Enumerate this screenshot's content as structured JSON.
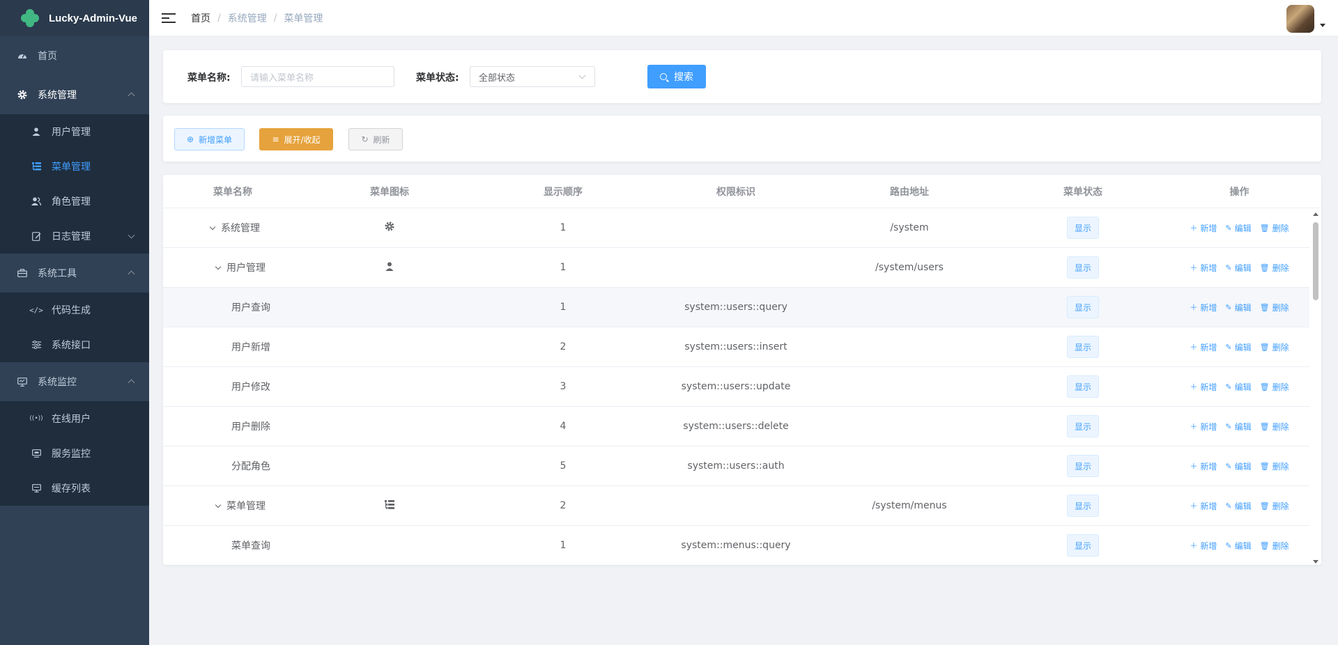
{
  "app": {
    "title": "Lucky-Admin-Vue"
  },
  "sidebar": {
    "home": "首页",
    "groups": [
      {
        "label": "系统管理",
        "expanded": true,
        "items": [
          {
            "label": "用户管理",
            "icon": "user-icon"
          },
          {
            "label": "菜单管理",
            "icon": "tree-table-icon",
            "active": true
          },
          {
            "label": "角色管理",
            "icon": "peoples-icon"
          },
          {
            "label": "日志管理",
            "icon": "log-icon",
            "collapsed_arrow": true
          }
        ]
      },
      {
        "label": "系统工具",
        "expanded": true,
        "items": [
          {
            "label": "代码生成",
            "icon": "code-icon"
          },
          {
            "label": "系统接口",
            "icon": "sliders-icon"
          }
        ]
      },
      {
        "label": "系统监控",
        "expanded": true,
        "items": [
          {
            "label": "在线用户",
            "icon": "online-icon"
          },
          {
            "label": "服务监控",
            "icon": "server-icon"
          },
          {
            "label": "缓存列表",
            "icon": "monitor-icon"
          }
        ]
      }
    ]
  },
  "breadcrumb": {
    "home": "首页",
    "level1": "系统管理",
    "level2": "菜单管理",
    "sep": "/"
  },
  "search": {
    "name_label": "菜单名称:",
    "name_placeholder": "请输入菜单名称",
    "status_label": "菜单状态:",
    "status_value": "全部状态",
    "search_button": "搜索"
  },
  "toolbar": {
    "add": "新增菜单",
    "expand": "展开/收起",
    "refresh": "刷新"
  },
  "table": {
    "headers": [
      "菜单名称",
      "菜单图标",
      "显示顺序",
      "权限标识",
      "路由地址",
      "菜单状态",
      "操作"
    ],
    "ops": {
      "add": "新增",
      "edit": "编辑",
      "delete": "删除"
    },
    "rows": [
      {
        "name": "系统管理",
        "level": 0,
        "expandable": true,
        "icon": "gear-icon",
        "order": "1",
        "perm": "",
        "route": "/system",
        "status": "显示"
      },
      {
        "name": "用户管理",
        "level": 1,
        "expandable": true,
        "icon": "user-icon",
        "order": "1",
        "perm": "",
        "route": "/system/users",
        "status": "显示"
      },
      {
        "name": "用户查询",
        "level": 2,
        "expandable": false,
        "icon": "",
        "order": "1",
        "perm": "system::users::query",
        "route": "",
        "status": "显示",
        "hover": true
      },
      {
        "name": "用户新增",
        "level": 2,
        "expandable": false,
        "icon": "",
        "order": "2",
        "perm": "system::users::insert",
        "route": "",
        "status": "显示"
      },
      {
        "name": "用户修改",
        "level": 2,
        "expandable": false,
        "icon": "",
        "order": "3",
        "perm": "system::users::update",
        "route": "",
        "status": "显示"
      },
      {
        "name": "用户删除",
        "level": 2,
        "expandable": false,
        "icon": "",
        "order": "4",
        "perm": "system::users::delete",
        "route": "",
        "status": "显示"
      },
      {
        "name": "分配角色",
        "level": 2,
        "expandable": false,
        "icon": "",
        "order": "5",
        "perm": "system::users::auth",
        "route": "",
        "status": "显示"
      },
      {
        "name": "菜单管理",
        "level": 1,
        "expandable": true,
        "icon": "tree-table-icon",
        "order": "2",
        "perm": "",
        "route": "/system/menus",
        "status": "显示"
      },
      {
        "name": "菜单查询",
        "level": 2,
        "expandable": false,
        "icon": "",
        "order": "1",
        "perm": "system::menus::query",
        "route": "",
        "status": "显示"
      }
    ]
  },
  "colors": {
    "sidebar_bg": "#304156",
    "submenu_bg": "#1f2d3d",
    "primary": "#409eff",
    "warning": "#e6a23c"
  }
}
